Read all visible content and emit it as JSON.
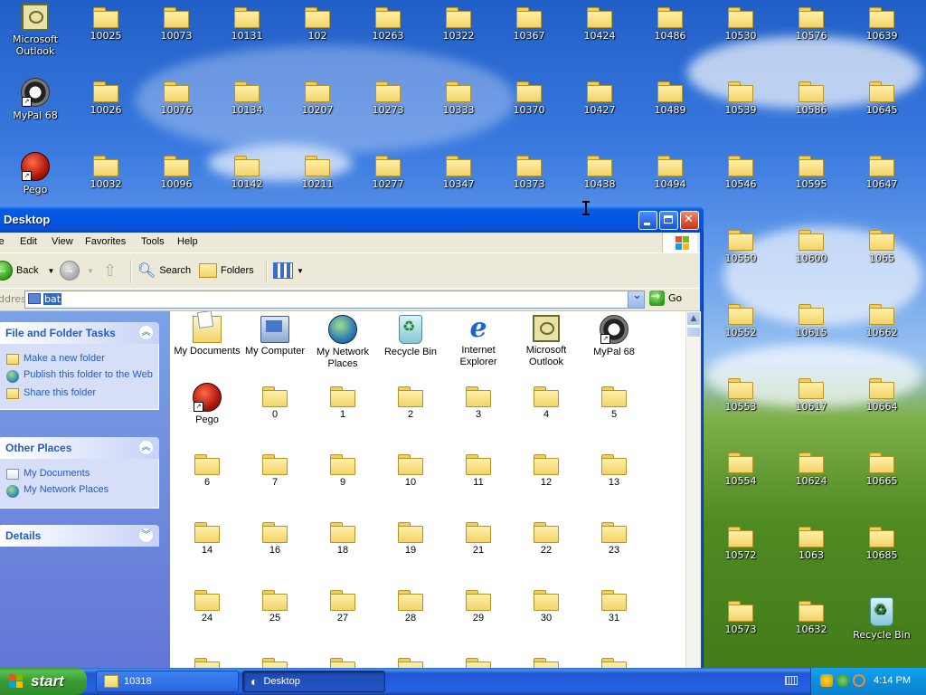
{
  "desktop": {
    "icons": [
      {
        "label": "Microsoft Outlook",
        "type": "outlook-icon"
      },
      {
        "label": "10025"
      },
      {
        "label": "10073"
      },
      {
        "label": "10131"
      },
      {
        "label": "102"
      },
      {
        "label": "10263"
      },
      {
        "label": "10322"
      },
      {
        "label": "10367"
      },
      {
        "label": "10424"
      },
      {
        "label": "10486"
      },
      {
        "label": "10530"
      },
      {
        "label": "10576"
      },
      {
        "label": "10639"
      },
      {
        "label": "MyPal 68",
        "type": "mypal-icon"
      },
      {
        "label": "10026"
      },
      {
        "label": "10076"
      },
      {
        "label": "10134"
      },
      {
        "label": "10207"
      },
      {
        "label": "10273"
      },
      {
        "label": "10333"
      },
      {
        "label": "10370"
      },
      {
        "label": "10427"
      },
      {
        "label": "10489"
      },
      {
        "label": "10539"
      },
      {
        "label": "10586"
      },
      {
        "label": "10645"
      },
      {
        "label": "Pego",
        "type": "pego-icon"
      },
      {
        "label": "10032"
      },
      {
        "label": "10096"
      },
      {
        "label": "10142"
      },
      {
        "label": "10211"
      },
      {
        "label": "10277"
      },
      {
        "label": "10347"
      },
      {
        "label": "10373"
      },
      {
        "label": "10438"
      },
      {
        "label": "10494"
      },
      {
        "label": "10546"
      },
      {
        "label": "10595"
      },
      {
        "label": "10647"
      }
    ],
    "right_column": [
      {
        "label": "10550"
      },
      {
        "label": "10600"
      },
      {
        "label": "1065"
      },
      {
        "label": "10552"
      },
      {
        "label": "10615"
      },
      {
        "label": "10662"
      },
      {
        "label": "10553"
      },
      {
        "label": "10617"
      },
      {
        "label": "10664"
      },
      {
        "label": "10554"
      },
      {
        "label": "10624"
      },
      {
        "label": "10665"
      },
      {
        "label": "10572"
      },
      {
        "label": "1063"
      },
      {
        "label": "10685"
      },
      {
        "label": "10573"
      },
      {
        "label": "10632"
      },
      {
        "label": "Recycle Bin",
        "type": "recycle-icon"
      }
    ]
  },
  "window": {
    "title": "Desktop",
    "menu": [
      "le",
      "Edit",
      "View",
      "Favorites",
      "Tools",
      "Help"
    ],
    "toolbar": {
      "back": "Back",
      "search": "Search",
      "folders": "Folders"
    },
    "address": {
      "label": "ddress",
      "value": "bat",
      "go": "Go"
    },
    "tasks": {
      "file_folder_title": "File and Folder Tasks",
      "file_folder_links": [
        "Make a new folder",
        "Publish this folder to the Web",
        "Share this folder"
      ],
      "other_places_title": "Other Places",
      "other_places_links": [
        "My Documents",
        "My Network Places"
      ],
      "details_title": "Details"
    },
    "items": [
      {
        "label": "My Documents",
        "type": "mydocs-icon"
      },
      {
        "label": "My Computer",
        "type": "computer-icon"
      },
      {
        "label": "My Network Places",
        "type": "network-icon"
      },
      {
        "label": "Recycle Bin",
        "type": "recycle-icon"
      },
      {
        "label": "Internet Explorer",
        "type": "ie-icon"
      },
      {
        "label": "Microsoft Outlook",
        "type": "outlook-icon"
      },
      {
        "label": "MyPal 68",
        "type": "mypal-icon"
      },
      {
        "label": "Pego",
        "type": "pego-icon"
      },
      {
        "label": "0"
      },
      {
        "label": "1"
      },
      {
        "label": "2"
      },
      {
        "label": "3"
      },
      {
        "label": "4"
      },
      {
        "label": "5"
      },
      {
        "label": "6"
      },
      {
        "label": "7"
      },
      {
        "label": "9"
      },
      {
        "label": "10"
      },
      {
        "label": "11"
      },
      {
        "label": "12"
      },
      {
        "label": "13"
      },
      {
        "label": "14"
      },
      {
        "label": "16"
      },
      {
        "label": "18"
      },
      {
        "label": "19"
      },
      {
        "label": "21"
      },
      {
        "label": "22"
      },
      {
        "label": "23"
      },
      {
        "label": "24"
      },
      {
        "label": "25"
      },
      {
        "label": "27"
      },
      {
        "label": "28"
      },
      {
        "label": "29"
      },
      {
        "label": "30"
      },
      {
        "label": "31"
      },
      {
        "label": ""
      },
      {
        "label": ""
      },
      {
        "label": ""
      },
      {
        "label": ""
      },
      {
        "label": ""
      },
      {
        "label": ""
      },
      {
        "label": ""
      }
    ]
  },
  "taskbar": {
    "start": "start",
    "tasks": [
      {
        "label": "10318"
      },
      {
        "label": "Desktop"
      }
    ],
    "clock": "4:14 PM"
  },
  "colors": {
    "xp_blue": "#0a4fd6",
    "link_blue": "#215dc6",
    "start_green": "#3a9a33"
  }
}
